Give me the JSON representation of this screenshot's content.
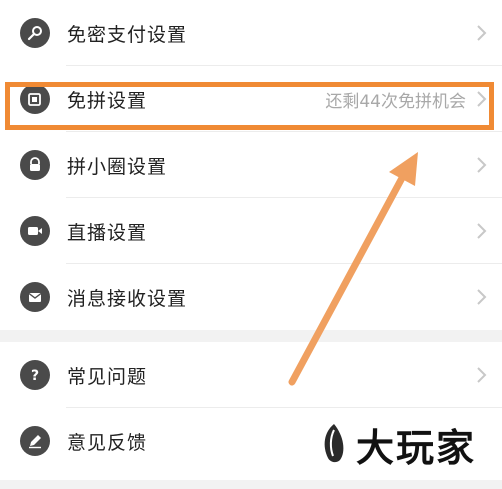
{
  "settings_group_1": {
    "items": [
      {
        "label": "免密支付设置",
        "icon": "key-icon"
      },
      {
        "label": "免拼设置",
        "detail": "还剩44次免拼机会",
        "icon": "card-icon"
      },
      {
        "label": "拼小圈设置",
        "icon": "lock-icon"
      },
      {
        "label": "直播设置",
        "icon": "video-camera-icon"
      },
      {
        "label": "消息接收设置",
        "icon": "mail-icon"
      }
    ]
  },
  "settings_group_2": {
    "items": [
      {
        "label": "常见问题",
        "icon": "question-icon"
      },
      {
        "label": "意见反馈",
        "icon": "pencil-icon"
      }
    ]
  },
  "annotation": {
    "highlight_color": "#f08a34",
    "arrow_color": "#f0a060",
    "highlighted_item": "免拼设置"
  },
  "watermark": {
    "text": "大玩家",
    "icon": "brush-logo-icon"
  },
  "colors": {
    "background": "#f2f2f2",
    "row_bg": "#ffffff",
    "icon_bg": "#4a4a4a",
    "label": "#222222",
    "detail": "#a8a8a8"
  }
}
